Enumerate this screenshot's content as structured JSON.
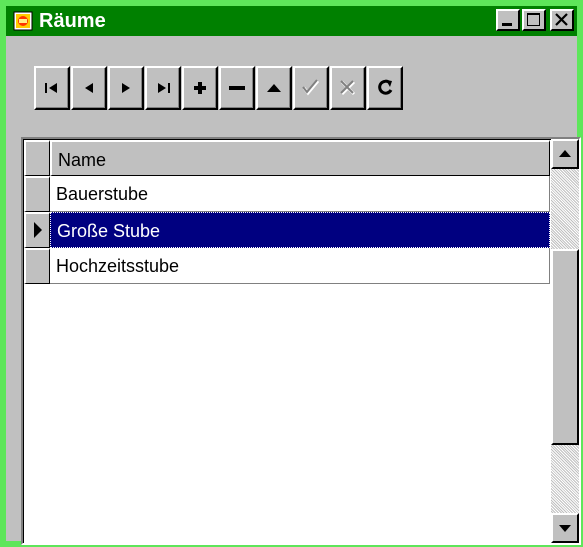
{
  "window": {
    "title": "Räume",
    "icon": "database-table-icon",
    "colors": {
      "frame": "#5ee65a",
      "titlebar": "#008000",
      "face": "#c0c0c0",
      "selection": "#000080"
    },
    "controls": [
      "minimize-icon",
      "maximize-icon",
      "close-icon"
    ]
  },
  "navigator": {
    "buttons": [
      {
        "name": "first",
        "icon": "first-record-icon",
        "enabled": true
      },
      {
        "name": "prior",
        "icon": "prior-record-icon",
        "enabled": true
      },
      {
        "name": "next",
        "icon": "next-record-icon",
        "enabled": true
      },
      {
        "name": "last",
        "icon": "last-record-icon",
        "enabled": true
      },
      {
        "name": "insert",
        "icon": "plus-icon",
        "enabled": true
      },
      {
        "name": "delete",
        "icon": "minus-icon",
        "enabled": true
      },
      {
        "name": "edit",
        "icon": "triangle-up-icon",
        "enabled": true
      },
      {
        "name": "post",
        "icon": "checkmark-icon",
        "enabled": false
      },
      {
        "name": "cancel",
        "icon": "cross-icon",
        "enabled": false
      },
      {
        "name": "refresh",
        "icon": "refresh-icon",
        "enabled": true
      }
    ]
  },
  "grid": {
    "columns": [
      "Name"
    ],
    "rows": [
      "Bauerstube",
      "Große Stube",
      "Hochzeitsstube"
    ],
    "selected_row": 1
  }
}
